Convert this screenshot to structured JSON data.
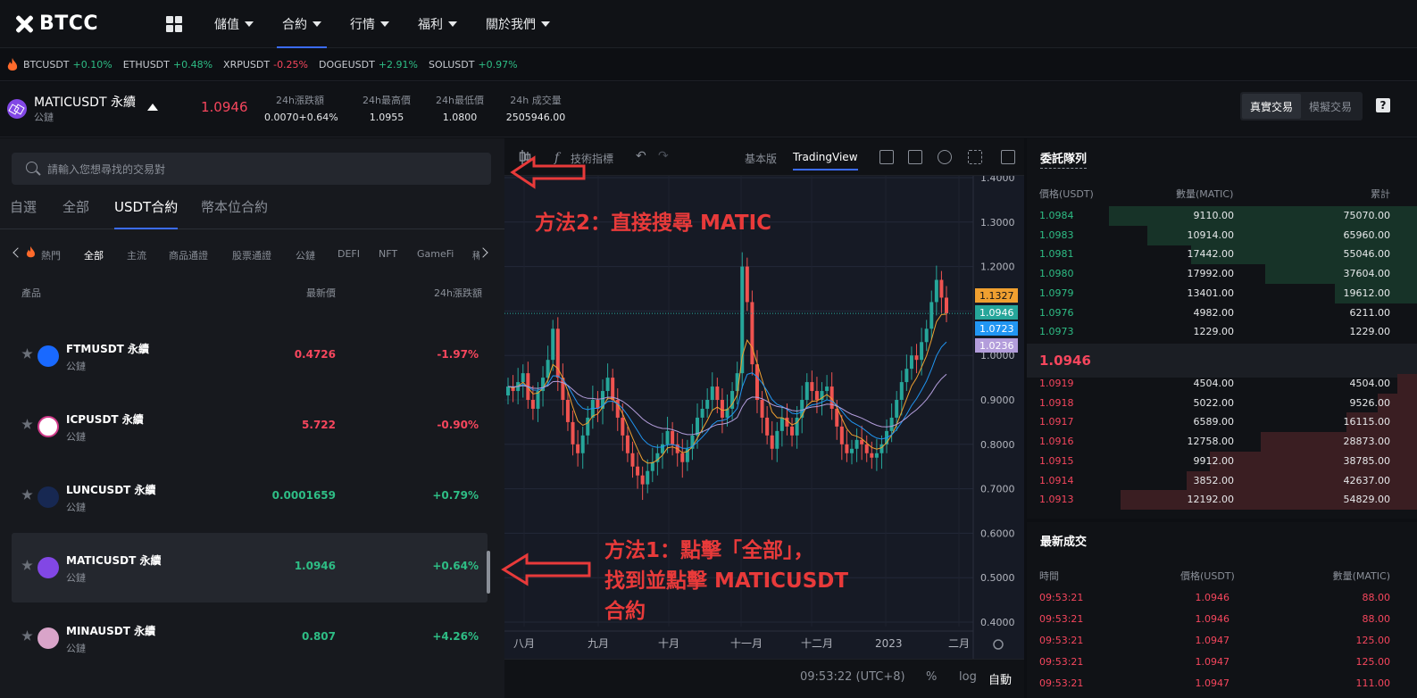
{
  "nav": {
    "logo": "BTCC",
    "items": [
      {
        "label": "儲值",
        "active": false
      },
      {
        "label": "合約",
        "active": true
      },
      {
        "label": "行情",
        "active": false
      },
      {
        "label": "福利",
        "active": false
      },
      {
        "label": "關於我們",
        "active": false
      }
    ]
  },
  "ticker": [
    {
      "sym": "BTCUSDT",
      "chg": "+0.10%",
      "dir": "up"
    },
    {
      "sym": "ETHUSDT",
      "chg": "+0.48%",
      "dir": "up"
    },
    {
      "sym": "XRPUSDT",
      "chg": "-0.25%",
      "dir": "down"
    },
    {
      "sym": "DOGEUSDT",
      "chg": "+2.91%",
      "dir": "up"
    },
    {
      "sym": "SOLUSDT",
      "chg": "+0.97%",
      "dir": "up"
    }
  ],
  "symbol": {
    "name": "MATICUSDT 永續",
    "sub": "公鏈",
    "price": "1.0946",
    "stats": [
      {
        "label": "24h漲跌額",
        "value": "0.0070+0.64%",
        "dir": "up"
      },
      {
        "label": "24h最高價",
        "value": "1.0955",
        "dir": ""
      },
      {
        "label": "24h最低價",
        "value": "1.0800",
        "dir": ""
      },
      {
        "label": "24h 成交量",
        "value": "2505946.00",
        "dir": ""
      }
    ],
    "mode_real": "真實交易",
    "mode_demo": "模擬交易",
    "help": "?"
  },
  "left": {
    "search_placeholder": "請輸入您想尋找的交易對",
    "tabs": [
      "自選",
      "全部",
      "USDT合約",
      "幣本位合約"
    ],
    "active_tab": 2,
    "categories": [
      "熱門",
      "全部",
      "主流",
      "商品通證",
      "股票通證",
      "公鏈",
      "DEFI",
      "NFT",
      "GameFi",
      "稀"
    ],
    "active_category": 1,
    "col_product": "產品",
    "col_price": "最新價",
    "col_change": "24h漲跌額",
    "rows": [
      {
        "name": "FTMUSDT 永續",
        "sub": "公鏈",
        "price": "0.4726",
        "change": "-1.97%",
        "dir": "down",
        "color": "#1969ff",
        "selected": false
      },
      {
        "name": "ICPUSDT 永續",
        "sub": "公鏈",
        "price": "5.722",
        "change": "-0.90%",
        "dir": "down",
        "color": "#ffffff",
        "selected": false
      },
      {
        "name": "LUNCUSDT 永續",
        "sub": "公鏈",
        "price": "0.0001659",
        "change": "+0.79%",
        "dir": "up",
        "color": "#172852",
        "selected": false
      },
      {
        "name": "MATICUSDT 永續",
        "sub": "公鏈",
        "price": "1.0946",
        "change": "+0.64%",
        "dir": "up",
        "color": "#8247e5",
        "selected": true
      },
      {
        "name": "MINAUSDT 永續",
        "sub": "公鏈",
        "price": "0.807",
        "change": "+4.26%",
        "dir": "up",
        "color": "#d9a4c9",
        "selected": false
      }
    ]
  },
  "chart_toolbar": {
    "indicators": "技術指標",
    "basic": "基本版",
    "tradingview": "TradingView"
  },
  "chart_bottom": {
    "time": "09:53:22 (UTC+8)",
    "percent": "%",
    "log": "log",
    "auto": "自動"
  },
  "chart_data": {
    "type": "candlestick",
    "y_ticks": [
      "1.4000",
      "1.3000",
      "1.2000",
      "1.1000",
      "1.0000",
      "0.9000",
      "0.8000",
      "0.7000",
      "0.6000",
      "0.5000",
      "0.4000"
    ],
    "ylim": [
      0.4,
      1.4
    ],
    "x_ticks": [
      "八月",
      "九月",
      "十月",
      "十一月",
      "十二月",
      "2023",
      "二月"
    ],
    "price_tags": [
      {
        "value": 1.1327,
        "label": "1.1327",
        "color": "#f0a030"
      },
      {
        "value": 1.0946,
        "label": "1.0946",
        "color": "#26a69a"
      },
      {
        "value": 1.0723,
        "label": "1.0723",
        "color": "#2196f3"
      },
      {
        "value": 1.0236,
        "label": "1.0236",
        "color": "#b39ddb"
      }
    ],
    "closes": [
      0.93,
      0.92,
      0.94,
      0.96,
      0.9,
      0.88,
      0.92,
      0.95,
      0.99,
      1.06,
      0.95,
      0.9,
      0.85,
      0.8,
      0.78,
      0.82,
      0.86,
      0.9,
      0.88,
      0.92,
      0.95,
      0.9,
      0.86,
      0.82,
      0.78,
      0.75,
      0.73,
      0.71,
      0.74,
      0.76,
      0.78,
      0.8,
      0.83,
      0.8,
      0.78,
      0.76,
      0.79,
      0.82,
      0.86,
      0.88,
      0.9,
      0.93,
      0.9,
      0.86,
      0.88,
      0.92,
      0.96,
      1.2,
      1.12,
      0.98,
      0.9,
      0.86,
      0.82,
      0.79,
      0.83,
      0.86,
      0.84,
      0.82,
      0.86,
      0.9,
      0.94,
      0.92,
      0.9,
      0.92,
      0.93,
      0.88,
      0.84,
      0.8,
      0.78,
      0.79,
      0.81,
      0.8,
      0.78,
      0.77,
      0.78,
      0.8,
      0.83,
      0.86,
      0.9,
      0.94,
      0.97,
      1.0,
      0.99,
      1.03,
      1.06,
      1.12,
      1.17,
      1.13,
      1.0946
    ]
  },
  "annotations": {
    "method2": "方法2：直接搜尋 MATIC",
    "method1_line1": "方法1：點擊「全部」，",
    "method1_line2": "找到並點擊 MATICUSDT",
    "method1_line3": "合約"
  },
  "book": {
    "title": "委託隊列",
    "col_price": "價格(USDT)",
    "col_amount": "數量(MATIC)",
    "col_total": "累計",
    "bids": [
      {
        "price": "1.0984",
        "amount": "9110.00",
        "total": "75070.00",
        "depth": 0.79
      },
      {
        "price": "1.0983",
        "amount": "10914.00",
        "total": "65960.00",
        "depth": 0.69
      },
      {
        "price": "1.0981",
        "amount": "17442.00",
        "total": "55046.00",
        "depth": 0.58
      },
      {
        "price": "1.0980",
        "amount": "17992.00",
        "total": "37604.00",
        "depth": 0.39
      },
      {
        "price": "1.0979",
        "amount": "13401.00",
        "total": "19612.00",
        "depth": 0.21
      },
      {
        "price": "1.0976",
        "amount": "4982.00",
        "total": "6211.00",
        "depth": 0.0
      },
      {
        "price": "1.0973",
        "amount": "1229.00",
        "total": "1229.00",
        "depth": 0.0
      }
    ],
    "mid_price": "1.0946",
    "asks": [
      {
        "price": "1.0919",
        "amount": "4504.00",
        "total": "4504.00",
        "depth": 0.05
      },
      {
        "price": "1.0918",
        "amount": "5022.00",
        "total": "9526.00",
        "depth": 0.1
      },
      {
        "price": "1.0917",
        "amount": "6589.00",
        "total": "16115.00",
        "depth": 0.18
      },
      {
        "price": "1.0916",
        "amount": "12758.00",
        "total": "28873.00",
        "depth": 0.4
      },
      {
        "price": "1.0915",
        "amount": "9912.00",
        "total": "38785.00",
        "depth": 0.53
      },
      {
        "price": "1.0914",
        "amount": "3852.00",
        "total": "42637.00",
        "depth": 0.59
      },
      {
        "price": "1.0913",
        "amount": "12192.00",
        "total": "54829.00",
        "depth": 0.76
      }
    ]
  },
  "trades": {
    "title": "最新成交",
    "col_time": "時間",
    "col_price": "價格(USDT)",
    "col_amount": "數量(MATIC)",
    "rows": [
      {
        "time": "09:53:21",
        "price": "1.0946",
        "amount": "88.00"
      },
      {
        "time": "09:53:21",
        "price": "1.0946",
        "amount": "88.00"
      },
      {
        "time": "09:53:21",
        "price": "1.0947",
        "amount": "125.00"
      },
      {
        "time": "09:53:21",
        "price": "1.0947",
        "amount": "125.00"
      },
      {
        "time": "09:53:21",
        "price": "1.0947",
        "amount": "111.00"
      }
    ]
  }
}
